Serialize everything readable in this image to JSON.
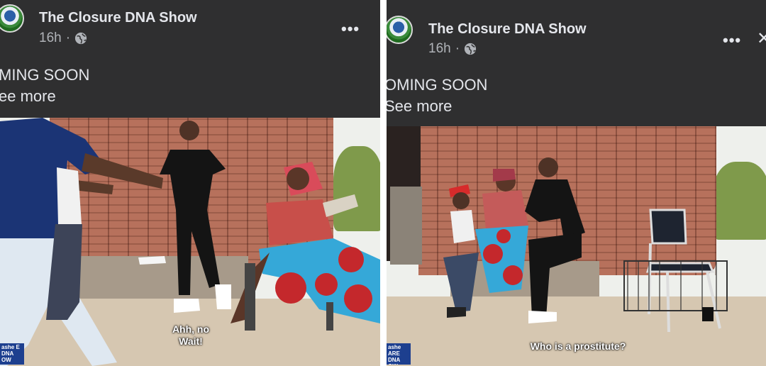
{
  "posts": [
    {
      "page_name": "The Closure DNA Show",
      "time": "16h",
      "separator": "·",
      "text": "MING SOON",
      "see_more": "ee more",
      "subtitle": "Ahh, no\nWait!",
      "logo_text": "ashe\nE DNA\nOW"
    },
    {
      "page_name": "The Closure DNA Show",
      "time": "16h",
      "separator": "·",
      "text": "OMING SOON",
      "see_more": "See more",
      "subtitle": "Who is a prostitute?",
      "logo_text": "ashe\nARE DNA\nOW"
    }
  ],
  "icons": {
    "more": "more-horizontal-icon",
    "close": "close-icon",
    "audience": "globe-icon"
  },
  "colors": {
    "post_background": "#2f2f30",
    "primary_text": "#e4e6eb",
    "secondary_text": "#b0b3b8",
    "video_badge": "#1d3f8f"
  }
}
